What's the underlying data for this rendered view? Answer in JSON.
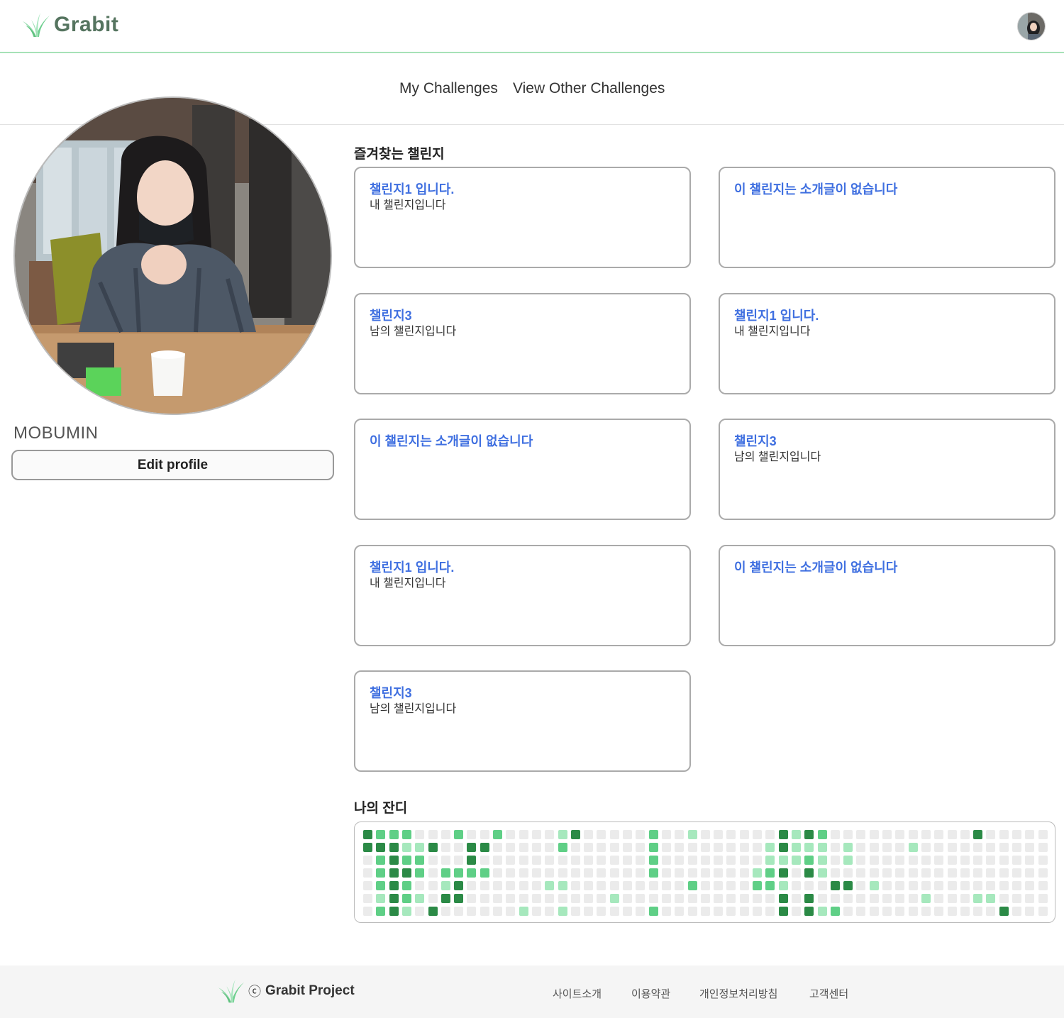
{
  "header": {
    "brand": "Grabit",
    "logo_icon": "grass-leaf-icon",
    "avatar_icon": "user-avatar"
  },
  "nav": {
    "my_challenges": "My Challenges",
    "other_challenges": "View Other Challenges"
  },
  "profile": {
    "username": "MOBUMIN",
    "edit_label": "Edit profile"
  },
  "favorites": {
    "title": "즐겨찾는 챌린지",
    "cards": [
      {
        "title": "챌린지1 입니다.",
        "desc": "내 챌린지입니다"
      },
      {
        "title": "이 챌린지는 소개글이 없습니다",
        "desc": ""
      },
      {
        "title": "챌린지3",
        "desc": "남의 챌린지입니다"
      },
      {
        "title": "챌린지1 입니다.",
        "desc": "내 챌린지입니다"
      },
      {
        "title": "이 챌린지는 소개글이 없습니다",
        "desc": ""
      },
      {
        "title": "챌린지3",
        "desc": "남의 챌린지입니다"
      },
      {
        "title": "챌린지1 입니다.",
        "desc": "내 챌린지입니다"
      },
      {
        "title": "이 챌린지는 소개글이 없습니다",
        "desc": ""
      },
      {
        "title": "챌린지3",
        "desc": "남의 챌린지입니다"
      }
    ]
  },
  "grass": {
    "title": "나의 잔디",
    "colors": {
      "0": "#ebebeb",
      "1": "#a6e8bd",
      "2": "#5fcf86",
      "3": "#2b8a46"
    },
    "weeks": [
      [
        3,
        3,
        0,
        0,
        0,
        0,
        0
      ],
      [
        2,
        3,
        2,
        2,
        2,
        1,
        2
      ],
      [
        2,
        3,
        3,
        3,
        3,
        3,
        3
      ],
      [
        2,
        1,
        2,
        3,
        2,
        2,
        1
      ],
      [
        0,
        1,
        2,
        2,
        0,
        1,
        0
      ],
      [
        0,
        3,
        0,
        0,
        0,
        0,
        3
      ],
      [
        0,
        0,
        0,
        2,
        1,
        3,
        0
      ],
      [
        2,
        0,
        0,
        2,
        3,
        3,
        0
      ],
      [
        0,
        3,
        3,
        2,
        0,
        0,
        0
      ],
      [
        0,
        3,
        0,
        2,
        0,
        0,
        0
      ],
      [
        2,
        0,
        0,
        0,
        0,
        0,
        0
      ],
      [
        0,
        0,
        0,
        0,
        0,
        0,
        0
      ],
      [
        0,
        0,
        0,
        0,
        0,
        0,
        1
      ],
      [
        0,
        0,
        0,
        0,
        0,
        0,
        0
      ],
      [
        0,
        0,
        0,
        0,
        1,
        0,
        0
      ],
      [
        1,
        2,
        0,
        0,
        1,
        0,
        1
      ],
      [
        3,
        0,
        0,
        0,
        0,
        0,
        0
      ],
      [
        0,
        0,
        0,
        0,
        0,
        0,
        0
      ],
      [
        0,
        0,
        0,
        0,
        0,
        0,
        0
      ],
      [
        0,
        0,
        0,
        0,
        0,
        1,
        0
      ],
      [
        0,
        0,
        0,
        0,
        0,
        0,
        0
      ],
      [
        0,
        0,
        0,
        0,
        0,
        0,
        0
      ],
      [
        2,
        2,
        2,
        2,
        0,
        0,
        2
      ],
      [
        0,
        0,
        0,
        0,
        0,
        0,
        0
      ],
      [
        0,
        0,
        0,
        0,
        0,
        0,
        0
      ],
      [
        1,
        0,
        0,
        0,
        2,
        0,
        0
      ],
      [
        0,
        0,
        0,
        0,
        0,
        0,
        0
      ],
      [
        0,
        0,
        0,
        0,
        0,
        0,
        0
      ],
      [
        0,
        0,
        0,
        0,
        0,
        0,
        0
      ],
      [
        0,
        0,
        0,
        0,
        0,
        0,
        0
      ],
      [
        0,
        0,
        0,
        1,
        2,
        0,
        0
      ],
      [
        0,
        1,
        1,
        2,
        2,
        0,
        0
      ],
      [
        3,
        3,
        1,
        3,
        1,
        3,
        3
      ],
      [
        1,
        1,
        1,
        0,
        0,
        0,
        0
      ],
      [
        3,
        1,
        2,
        3,
        0,
        3,
        3
      ],
      [
        2,
        1,
        1,
        1,
        0,
        0,
        1
      ],
      [
        0,
        0,
        0,
        0,
        3,
        0,
        2
      ],
      [
        0,
        1,
        1,
        0,
        3,
        0,
        0
      ],
      [
        0,
        0,
        0,
        0,
        0,
        0,
        0
      ],
      [
        0,
        0,
        0,
        0,
        1,
        0,
        0
      ],
      [
        0,
        0,
        0,
        0,
        0,
        0,
        0
      ],
      [
        0,
        0,
        0,
        0,
        0,
        0,
        0
      ],
      [
        0,
        1,
        0,
        0,
        0,
        0,
        0
      ],
      [
        0,
        0,
        0,
        0,
        0,
        1,
        0
      ],
      [
        0,
        0,
        0,
        0,
        0,
        0,
        0
      ],
      [
        0,
        0,
        0,
        0,
        0,
        0,
        0
      ],
      [
        0,
        0,
        0,
        0,
        0,
        0,
        0
      ],
      [
        3,
        0,
        0,
        0,
        0,
        1,
        0
      ],
      [
        0,
        0,
        0,
        0,
        0,
        1,
        0
      ],
      [
        0,
        0,
        0,
        0,
        0,
        0,
        3
      ],
      [
        0,
        0,
        0,
        0,
        0,
        0,
        0
      ],
      [
        0,
        0,
        0,
        0,
        0,
        0,
        0
      ],
      [
        0,
        0,
        0,
        0,
        0,
        0,
        0
      ]
    ]
  },
  "footer": {
    "copyright_symbol": "ⓒ",
    "brand": "Grabit Project",
    "links": [
      "사이트소개",
      "이용약관",
      "개인정보처리방침",
      "고객센터"
    ]
  }
}
